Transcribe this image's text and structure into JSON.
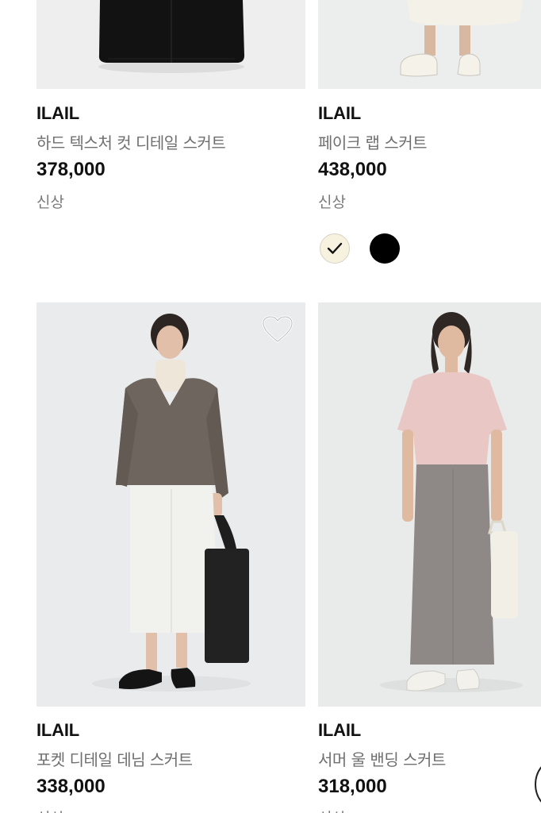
{
  "colors": {
    "brand_text": "#111111",
    "name_text": "#6f6f6f",
    "badge_text": "#7a7a7a",
    "image_bg": "#e9ebec"
  },
  "products": [
    {
      "brand": "ILAIL",
      "name": "하드 텍스처 컷 디테일 스커트",
      "price": "378,000",
      "badge": "신상",
      "image_icon": "skirt-black-photo"
    },
    {
      "brand": "ILAIL",
      "name": "페이크 랩 스커트",
      "price": "438,000",
      "badge": "신상",
      "image_icon": "skirt-ivory-photo",
      "swatches": [
        {
          "color": "#f7f1df",
          "selected": true
        },
        {
          "color": "#000000",
          "selected": false
        }
      ]
    },
    {
      "brand": "ILAIL",
      "name": "포켓 디테일 데님 스커트",
      "price": "338,000",
      "badge": "신상",
      "image_icon": "model-denim-skirt-photo",
      "wishlist_icon": "heart-outline-icon"
    },
    {
      "brand": "ILAIL",
      "name": "서머 울 밴딩 스커트",
      "price": "318,000",
      "badge": "신상",
      "image_icon": "model-wool-skirt-photo"
    }
  ]
}
